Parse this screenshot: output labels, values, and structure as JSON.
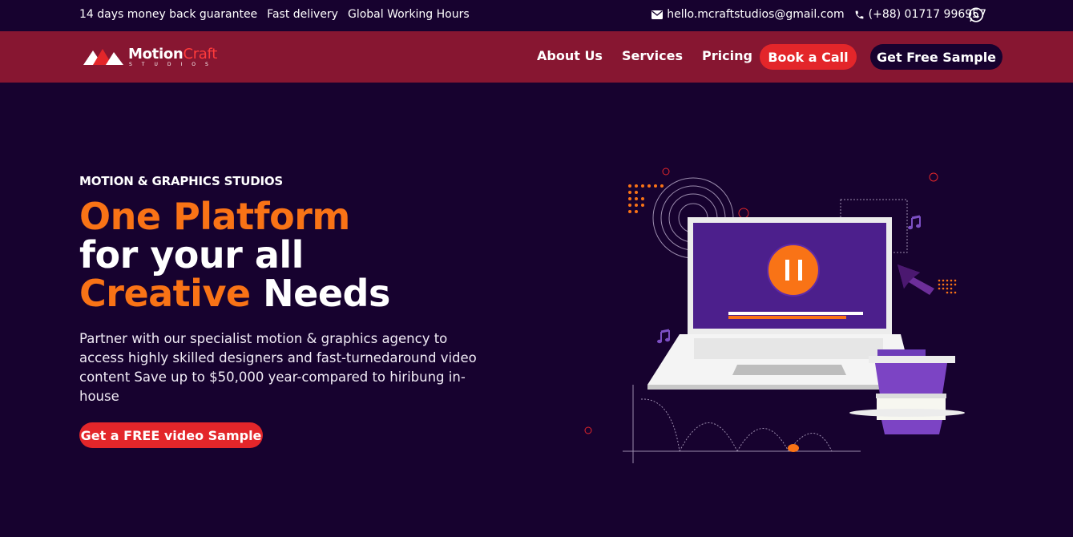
{
  "topbar": {
    "left_items": [
      "14 days money back guarantee",
      "Fast delivery",
      "Global Working Hours"
    ],
    "email": "hello.mcraftstudios@gmail.com",
    "phone": "(+88) 01717 996957",
    "icons": [
      "envelope-icon",
      "phone-icon",
      "whatsapp-icon"
    ]
  },
  "brand": {
    "name_part1": "Motion",
    "name_part2": "Craft",
    "subtitle": "STUDIOS"
  },
  "nav": {
    "links": [
      "About Us",
      "Services",
      "Pricing"
    ],
    "book_call": "Book a Call",
    "free_sample": "Get Free Sample"
  },
  "hero": {
    "tag": "MOTION & GRAPHICS STUDIOS",
    "line1": "One Platform",
    "line2": "for your all",
    "line3_highlight": "Creative",
    "line3_rest": "Needs",
    "description": "Partner with our specialist motion & graphics agency to access highly skilled designers and fast-turnedaround video content Save up to $50,000 year-compared to hiribung in-house",
    "cta": "Get a FREE video Sample"
  },
  "colors": {
    "background": "#17022f",
    "navbar": "#871631",
    "accent_red": "#e3262a",
    "accent_orange": "#f97316",
    "screen_purple": "#4c1f8c"
  }
}
